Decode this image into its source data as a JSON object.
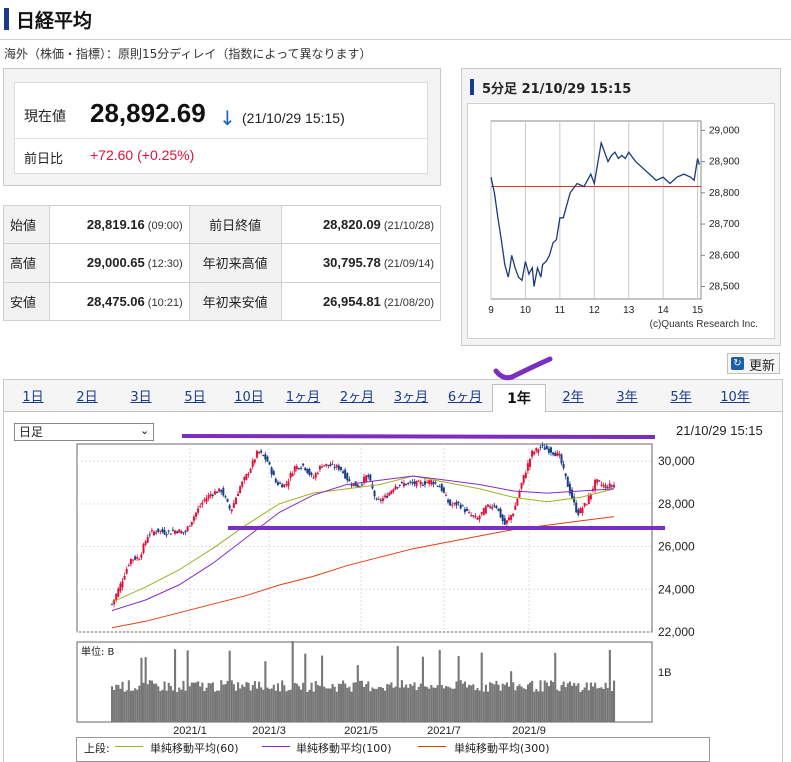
{
  "page": {
    "title": "日経平均",
    "subtitle": "海外（株価・指標）：原則15分ディレイ（指数によって異なります）"
  },
  "quote": {
    "current_label": "現在値",
    "current_value": "28,892.69",
    "direction_icon": "down-arrow-icon",
    "current_time": "(21/10/29 15:15)",
    "prev_label": "前日比",
    "change": "+72.60 (+0.25%)",
    "colors": {
      "down": "#1a5fd0",
      "up_change": "#e0103a"
    }
  },
  "stats": [
    {
      "label": "始値",
      "value": "28,819.16",
      "time": "(09:00)",
      "label2": "前日終値",
      "value2": "28,820.09",
      "time2": "(21/10/28)"
    },
    {
      "label": "高値",
      "value": "29,000.65",
      "time": "(12:30)",
      "label2": "年初来高値",
      "value2": "30,795.78",
      "time2": "(21/09/14)"
    },
    {
      "label": "安値",
      "value": "28,475.06",
      "time": "(10:21)",
      "label2": "年初来安値",
      "value2": "26,954.81",
      "time2": "(21/08/20)"
    }
  ],
  "mini_chart": {
    "title": "5分足 21/10/29 15:15",
    "credit": "(c)Quants Research Inc.",
    "chart_data": {
      "type": "line",
      "x_ticks": [
        "9",
        "10",
        "11",
        "12",
        "13",
        "14",
        "15"
      ],
      "y_ticks": [
        "29,000",
        "28,900",
        "28,800",
        "28,700",
        "28,600",
        "28,500"
      ],
      "ylim": [
        28460,
        29030
      ],
      "xlim": [
        9,
        15.1
      ],
      "reference_value": 28820.09,
      "x": [
        9.0,
        9.1,
        9.2,
        9.3,
        9.4,
        9.5,
        9.55,
        9.6,
        9.7,
        9.8,
        9.9,
        10.0,
        10.1,
        10.2,
        10.25,
        10.35,
        10.45,
        10.5,
        10.6,
        10.7,
        10.8,
        10.9,
        11.0,
        11.1,
        11.2,
        11.3,
        11.5,
        11.7,
        11.9,
        12.0,
        12.2,
        12.4,
        12.5,
        12.6,
        12.7,
        12.8,
        12.9,
        13.0,
        13.2,
        13.4,
        13.6,
        13.8,
        14.0,
        14.2,
        14.4,
        14.6,
        14.8,
        14.9,
        15.0,
        15.05
      ],
      "values": [
        28850,
        28800,
        28720,
        28650,
        28570,
        28530,
        28560,
        28600,
        28560,
        28530,
        28520,
        28580,
        28540,
        28560,
        28500,
        28560,
        28530,
        28570,
        28580,
        28600,
        28640,
        28650,
        28720,
        28720,
        28760,
        28800,
        28830,
        28820,
        28860,
        28830,
        28960,
        28900,
        28920,
        28930,
        28910,
        28920,
        28910,
        28930,
        28900,
        28880,
        28860,
        28840,
        28850,
        28830,
        28850,
        28860,
        28850,
        28840,
        28910,
        28890
      ],
      "colors": {
        "line": "#1a3b7a",
        "reference": "#e03030"
      }
    }
  },
  "refresh": {
    "label": "更新"
  },
  "tabs": [
    "1日",
    "2日",
    "3日",
    "5日",
    "10日",
    "1ヶ月",
    "2ヶ月",
    "3ヶ月",
    "6ヶ月",
    "1年",
    "2年",
    "3年",
    "5年",
    "10年"
  ],
  "active_tab": "1年",
  "controls": {
    "interval": "日足",
    "chart_time": "21/10/29 15:15"
  },
  "main_chart": {
    "chart_data": {
      "type": "candlestick",
      "x_ticks": [
        "2021/1",
        "2021/3",
        "2021/5",
        "2021/7",
        "2021/9"
      ],
      "y_ticks": [
        "30,000",
        "28,000",
        "26,000",
        "24,000",
        "22,000"
      ],
      "ylim": [
        22000,
        30800
      ],
      "price_series": [
        [
          "2020/11/2",
          23300
        ],
        [
          "2020/11/6",
          24300
        ],
        [
          "2020/11/13",
          25400
        ],
        [
          "2020/11/20",
          25500
        ],
        [
          "2020/11/27",
          26600
        ],
        [
          "2020/12/4",
          26750
        ],
        [
          "2020/12/11",
          26650
        ],
        [
          "2020/12/18",
          26760
        ],
        [
          "2020/12/25",
          26650
        ],
        [
          "2020/12/30",
          27440
        ],
        [
          "2021/1/8",
          28140
        ],
        [
          "2021/1/15",
          28520
        ],
        [
          "2021/1/22",
          28630
        ],
        [
          "2021/1/29",
          27660
        ],
        [
          "2021/2/5",
          28780
        ],
        [
          "2021/2/12",
          29520
        ],
        [
          "2021/2/16",
          30470
        ],
        [
          "2021/2/19",
          30020
        ],
        [
          "2021/2/26",
          28960
        ],
        [
          "2021/3/5",
          28860
        ],
        [
          "2021/3/12",
          29720
        ],
        [
          "2021/3/19",
          29790
        ],
        [
          "2021/3/26",
          29180
        ],
        [
          "2021/4/2",
          29850
        ],
        [
          "2021/4/9",
          29770
        ],
        [
          "2021/4/16",
          29680
        ],
        [
          "2021/4/23",
          29020
        ],
        [
          "2021/4/30",
          28810
        ],
        [
          "2021/5/7",
          29360
        ],
        [
          "2021/5/14",
          28080
        ],
        [
          "2021/5/21",
          28320
        ],
        [
          "2021/5/28",
          28860
        ],
        [
          "2021/6/4",
          28940
        ],
        [
          "2021/6/11",
          28950
        ],
        [
          "2021/6/18",
          28960
        ],
        [
          "2021/6/25",
          29070
        ],
        [
          "2021/7/2",
          28780
        ],
        [
          "2021/7/9",
          27940
        ],
        [
          "2021/7/16",
          28000
        ],
        [
          "2021/7/21",
          27550
        ],
        [
          "2021/7/30",
          27280
        ],
        [
          "2021/8/6",
          27820
        ],
        [
          "2021/8/13",
          27980
        ],
        [
          "2021/8/20",
          27010
        ],
        [
          "2021/8/27",
          27640
        ],
        [
          "2021/9/3",
          29130
        ],
        [
          "2021/9/10",
          30380
        ],
        [
          "2021/9/14",
          30670
        ],
        [
          "2021/9/17",
          30500
        ],
        [
          "2021/9/24",
          30250
        ],
        [
          "2021/10/1",
          28770
        ],
        [
          "2021/10/6",
          27530
        ],
        [
          "2021/10/8",
          28050
        ],
        [
          "2021/10/15",
          29070
        ],
        [
          "2021/10/22",
          28800
        ],
        [
          "2021/10/29",
          28890
        ]
      ],
      "sma60": [
        23400,
        24100,
        24900,
        25900,
        27000,
        28000,
        28500,
        28700,
        28900,
        29300,
        29000,
        28700,
        28300,
        28100,
        28300,
        28700
      ],
      "sma100": [
        23000,
        23500,
        24200,
        25200,
        26400,
        27600,
        28400,
        28900,
        29100,
        29300,
        29100,
        28900,
        28600,
        28500,
        28600,
        28700
      ],
      "sma300": [
        22200,
        22500,
        22900,
        23300,
        23700,
        24200,
        24600,
        25100,
        25500,
        25900,
        26200,
        26500,
        26800,
        27000,
        27200,
        27400
      ],
      "volume_label": "単位: B",
      "volume_tick": "1B",
      "legend": {
        "prefix": "上段:",
        "sma60": "単純移動平均(60)",
        "sma100": "単純移動平均(100)",
        "sma300": "単純移動平均(300)"
      },
      "colors": {
        "up": "#e0103a",
        "down": "#1a3b8a",
        "sma60": "#a0b020",
        "sma100": "#8a2ac0",
        "sma300": "#e04010",
        "volume": "#777777",
        "annotation": "#7a2fc0"
      }
    }
  }
}
